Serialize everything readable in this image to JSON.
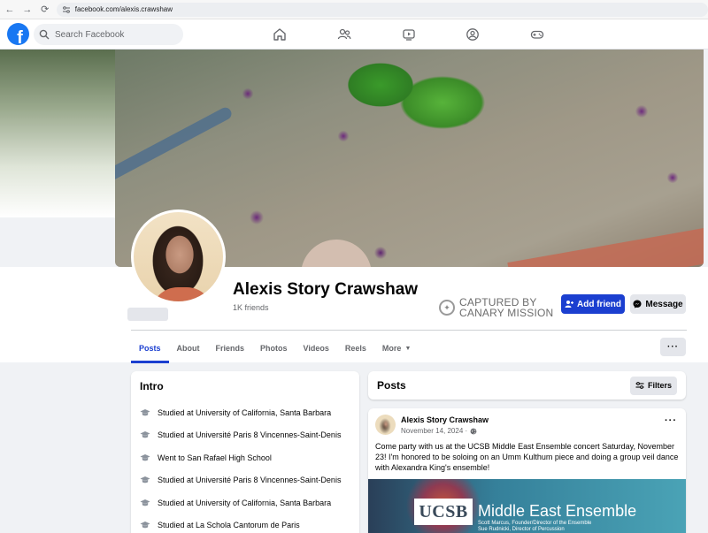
{
  "browser": {
    "url": "facebook.com/alexis.crawshaw"
  },
  "topbar": {
    "logo": "f",
    "search_placeholder": "Search Facebook"
  },
  "profile": {
    "name": "Alexis Story Crawshaw",
    "friends": "1K friends",
    "badge_line1": "CAPTURED BY",
    "badge_line2": "CANARY MISSION",
    "add_friend_label": "Add friend",
    "message_label": "Message",
    "more_label": "···"
  },
  "tabs": [
    {
      "label": "Posts",
      "active": true
    },
    {
      "label": "About"
    },
    {
      "label": "Friends"
    },
    {
      "label": "Photos"
    },
    {
      "label": "Videos"
    },
    {
      "label": "Reels"
    },
    {
      "label": "More"
    }
  ],
  "intro": {
    "title": "Intro",
    "items": [
      "Studied at University of California, Santa Barbara",
      "Studied at Université Paris 8 Vincennes-Saint-Denis",
      "Went to San Rafael High School",
      "Studied at Université Paris 8 Vincennes-Saint-Denis",
      "Studied at University of California, Santa Barbara",
      "Studied at La Schola Cantorum de Paris"
    ]
  },
  "posts": {
    "title": "Posts",
    "filters_label": "Filters",
    "post": {
      "author": "Alexis Story Crawshaw",
      "date": "November 14, 2024 ·",
      "dots": "···",
      "text": "Come party with us at the UCSB Middle East Ensemble concert Saturday, November 23! I'm honored to be soloing on an Umm Kulthum piece and doing a group veil dance with Alexandra King's ensemble!",
      "image_logo": "UCSB",
      "image_title": "Middle East Ensemble",
      "image_credit_1": "Scott Marcus, Founder/Director of the Ensemble",
      "image_credit_2": "Sue Rudnicki, Director of Percussion"
    }
  },
  "colors": {
    "accent": "#1b3fd0",
    "fb_blue": "#1877f2",
    "page_bg": "#f0f2f5"
  }
}
